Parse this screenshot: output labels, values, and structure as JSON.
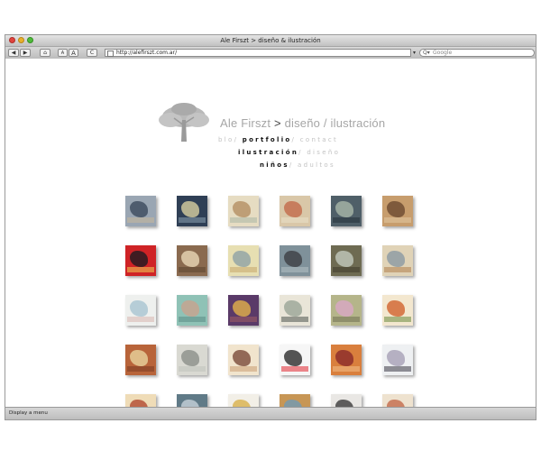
{
  "window": {
    "title": "Ale Firszt > diseño & ilustración"
  },
  "toolbar": {
    "back_label": "◀",
    "forward_label": "▶",
    "home_label": "⌂",
    "text_small_label": "A",
    "text_large_label": "A",
    "reload_label": "C",
    "url": "http://alefirszt.com.ar/",
    "search_placeholder": "Google"
  },
  "site": {
    "title_name": "Ale Firszt ",
    "title_sep": ">",
    "title_rest": " diseño / ilustración",
    "nav": {
      "blog": "blo",
      "sep1": "/ ",
      "portfolio": "portfolio",
      "sep2": "/ ",
      "contact": "contact"
    },
    "subnav": {
      "ilustracion": "ilustración",
      "sep": "/ ",
      "diseno": "diseño"
    },
    "subsubnav": {
      "ninos": "niños",
      "sep": "/ ",
      "adultos": "adultos"
    }
  },
  "status": {
    "text": "Display a menu"
  },
  "thumbs": [
    {
      "c": "#9aa6b3",
      "f": "#3b4a5c",
      "g": "#c9b89a"
    },
    {
      "c": "#2f3f55",
      "f": "#d8cfa0",
      "g": "#8aa0b0"
    },
    {
      "c": "#e6dcc2",
      "f": "#b48e63",
      "g": "#a9b7a5"
    },
    {
      "c": "#d9c7a8",
      "f": "#c26a4a",
      "g": "#e9e0c9"
    },
    {
      "c": "#4f5f68",
      "f": "#a7b6a8",
      "g": "#243038"
    },
    {
      "c": "#c79d6d",
      "f": "#6b4a30",
      "g": "#e2c9a2"
    },
    {
      "c": "#cf2326",
      "f": "#1c1a22",
      "g": "#f2d257"
    },
    {
      "c": "#8a6a4f",
      "f": "#e8d7b5",
      "g": "#5b4330"
    },
    {
      "c": "#e7dfb2",
      "f": "#8fa1a5",
      "g": "#c7a66c"
    },
    {
      "c": "#7f919a",
      "f": "#3d3f43",
      "g": "#b4c1c4"
    },
    {
      "c": "#6e6b52",
      "f": "#c2c9bd",
      "g": "#3f3a2a"
    },
    {
      "c": "#e0d3b7",
      "f": "#8b9aa2",
      "g": "#b17f4f"
    },
    {
      "c": "#eef0ee",
      "f": "#a7c4d1",
      "g": "#d9b6b0"
    },
    {
      "c": "#8fc2b6",
      "f": "#c8a28e",
      "g": "#5b8d85"
    },
    {
      "c": "#5a3a68",
      "f": "#e2b24a",
      "g": "#a05c62"
    },
    {
      "c": "#e9e5d8",
      "f": "#9aa597",
      "g": "#4f5650"
    },
    {
      "c": "#b5b58a",
      "f": "#d9a7c4",
      "g": "#6f7052"
    },
    {
      "c": "#f3e7cf",
      "f": "#d1632d",
      "g": "#6a8a3f"
    },
    {
      "c": "#b8643a",
      "f": "#e9d39e",
      "g": "#7a3a22"
    },
    {
      "c": "#d9d9d2",
      "f": "#8b8f8a",
      "g": "#bfc2bb"
    },
    {
      "c": "#f1e4cd",
      "f": "#7a4a3a",
      "g": "#c89c73"
    },
    {
      "c": "#f6f6f6",
      "f": "#2c2c2c",
      "g": "#e2262f"
    },
    {
      "c": "#d97f3d",
      "f": "#8a2a2a",
      "g": "#f2c08a"
    },
    {
      "c": "#eef0f2",
      "f": "#a6a0b5",
      "g": "#3c3a45"
    },
    {
      "c": "#efdcb7",
      "f": "#b1482f",
      "g": "#e7c78c"
    },
    {
      "c": "#607a87",
      "f": "#c7d2d9",
      "g": "#2f3f48"
    },
    {
      "c": "#f2efe7",
      "f": "#d8b04b",
      "g": "#9aa3a8"
    },
    {
      "c": "#c79655",
      "f": "#6f9ab5",
      "g": "#8b5a2e"
    },
    {
      "c": "#e9e7e4",
      "f": "#3a3a3a",
      "g": "#c9c4bd"
    },
    {
      "c": "#eee2cf",
      "f": "#c36a4a",
      "g": "#3a2a22"
    }
  ]
}
